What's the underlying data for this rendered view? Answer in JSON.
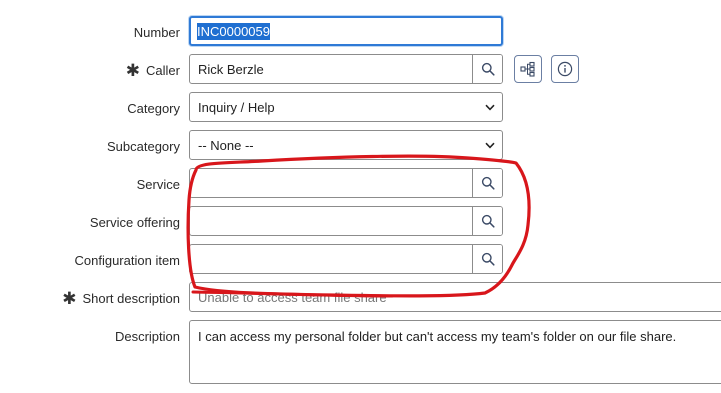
{
  "form": {
    "number": {
      "label": "Number",
      "value": "INC0000059"
    },
    "caller": {
      "required_mark": "✱",
      "label": "Caller",
      "value": "Rick Berzle"
    },
    "category": {
      "label": "Category",
      "value": "Inquiry / Help"
    },
    "subcategory": {
      "label": "Subcategory",
      "value": "-- None --"
    },
    "service": {
      "label": "Service",
      "value": ""
    },
    "service_offering": {
      "label": "Service offering",
      "value": ""
    },
    "configuration_item": {
      "label": "Configuration item",
      "value": ""
    },
    "short_description": {
      "required_mark": "✱",
      "label": "Short description",
      "value": "Unable to access team file share"
    },
    "description": {
      "label": "Description",
      "value": "I can access my personal folder but can't access my team's folder on our file share."
    }
  },
  "icons": {
    "lookup": "search-icon",
    "dependency": "hierarchy-icon",
    "info": "info-icon",
    "dropdown": "chevron-down-icon"
  },
  "colors": {
    "focus_border": "#2f7ad6",
    "selection": "#1f6fd1",
    "annotation": "#d8161b"
  }
}
